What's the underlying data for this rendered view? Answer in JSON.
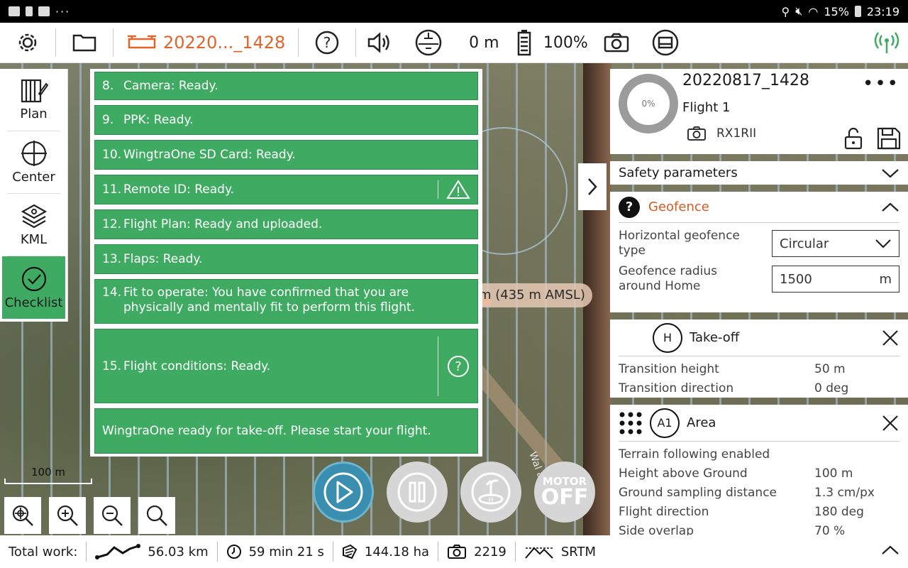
{
  "status_bar": {
    "battery": "15%",
    "time": "23:19"
  },
  "toolbar": {
    "flight_name": "20220..._1428",
    "altitude": "0 m",
    "battery": "100%"
  },
  "sidebar": {
    "items": [
      {
        "label": "Plan"
      },
      {
        "label": "Center"
      },
      {
        "label": "KML"
      },
      {
        "label": "Checklist"
      }
    ]
  },
  "checklist": {
    "items": [
      {
        "num": "8.",
        "text": "Camera: Ready."
      },
      {
        "num": "9.",
        "text": "PPK: Ready."
      },
      {
        "num": "10.",
        "text": "WingtraOne SD Card: Ready."
      },
      {
        "num": "11.",
        "text": "Remote ID: Ready."
      },
      {
        "num": "12.",
        "text": "Flight Plan: Ready and uploaded."
      },
      {
        "num": "13.",
        "text": "Flaps: Ready."
      },
      {
        "num": "14.",
        "text": "Fit to operate: You have confirmed that you are physically and mentally fit to perform this flight."
      },
      {
        "num": "15.",
        "text": "Flight conditions: Ready."
      }
    ],
    "final_message": "WingtraOne ready for take-off. Please start your flight."
  },
  "map": {
    "amsl_label": "m (435 m AMSL)",
    "road_text": "Wal ass",
    "scale_label": "100 m"
  },
  "flight_panel": {
    "progress": "0%",
    "title": "20220817_1428",
    "flight": "Flight 1",
    "camera": "RX1RII",
    "safety_label": "Safety parameters",
    "geofence": {
      "title": "Geofence",
      "type_label": "Horizontal geofence type",
      "type_value": "Circular",
      "radius_label": "Geofence radius around Home",
      "radius_value": "1500",
      "radius_unit": "m"
    },
    "takeoff": {
      "badge": "H",
      "title": "Take-off",
      "props": [
        {
          "k": "Transition height",
          "v": "50 m"
        },
        {
          "k": "Transition direction",
          "v": "0 deg"
        }
      ]
    },
    "area": {
      "badge": "A1",
      "title": "Area",
      "terrain": "Terrain following enabled",
      "props": [
        {
          "k": "Height above Ground",
          "v": "100 m"
        },
        {
          "k": "Ground sampling distance",
          "v": "1.3 cm/px"
        },
        {
          "k": "Flight direction",
          "v": "180 deg"
        },
        {
          "k": "Side overlap",
          "v": "70 %"
        }
      ]
    }
  },
  "controls": {
    "motor_top": "MOTOR",
    "motor_bottom": "OFF"
  },
  "summary": {
    "label": "Total work:",
    "distance": "56.03 km",
    "duration": "59 min 21 s",
    "area": "144.18 ha",
    "photos": "2219",
    "terrain": "SRTM"
  },
  "colors": {
    "accent_green": "#3fab62",
    "flight_orange": "#e0632a",
    "play_blue": "#3a8fb0"
  }
}
